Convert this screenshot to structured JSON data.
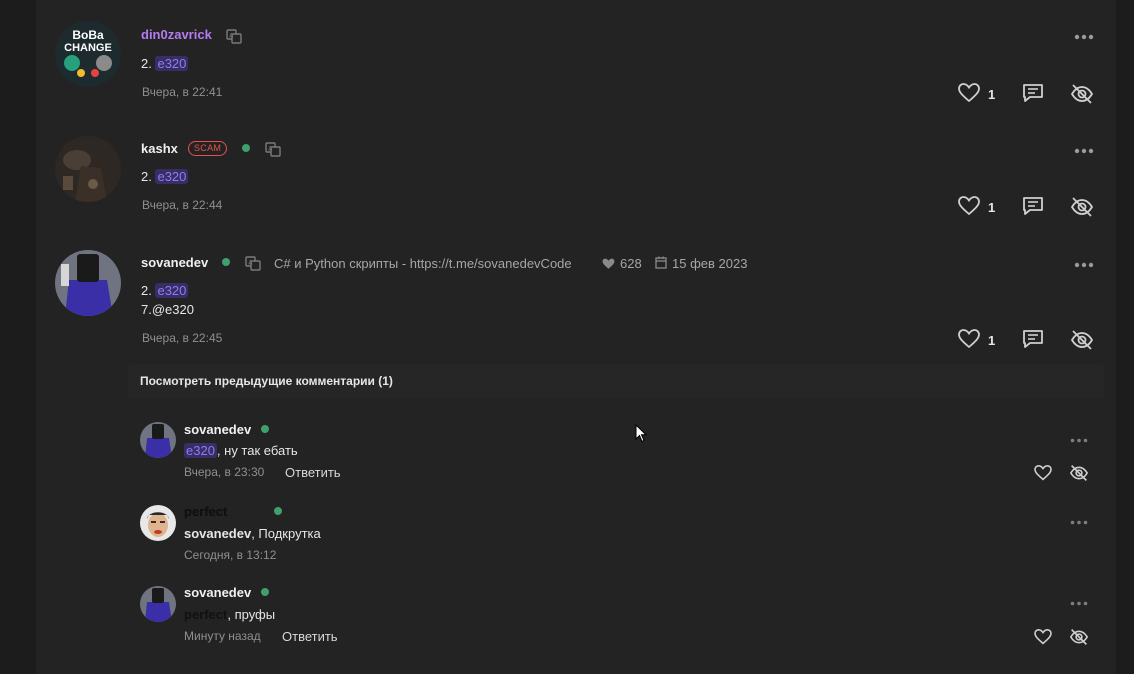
{
  "posts": [
    {
      "username": "din0zavrick",
      "number_label": "2.",
      "mention": "e320",
      "timestamp": "Вчера, в 22:41",
      "likes": "1"
    },
    {
      "username": "kashx",
      "badge": "SCAM",
      "number_label": "2.",
      "mention": "e320",
      "timestamp": "Вчера, в 22:44",
      "likes": "1"
    },
    {
      "username": "sovanedev",
      "status": "C# и Python скрипты - https://t.me/sovanedevCode",
      "reputation": "628",
      "registered": "15 фев 2023",
      "number_label": "2.",
      "mention": "e320",
      "line2": "7.@e320",
      "timestamp": "Вчера, в 22:45",
      "likes": "1"
    }
  ],
  "avatar_text": {
    "line1": "BoBa",
    "line2": "CHANGE"
  },
  "show_previous": "Посмотреть предыдущие комментарии (1)",
  "comments": [
    {
      "username": "sovanedev",
      "mention": "e320",
      "text": ", ну так ебать",
      "timestamp": "Вчера, в 23:30",
      "reply": "Ответить"
    },
    {
      "username": "perfect",
      "mention": "sovanedev",
      "text": ", Подкрутка",
      "timestamp": "Сегодня, в 13:12"
    },
    {
      "username": "sovanedev",
      "mention": "perfect",
      "text": ", пруфы",
      "timestamp": "Минуту назад",
      "reply": "Ответить"
    }
  ],
  "colors": {
    "mention_fg": "#8b7df2",
    "mention_bg": "#3a2d66",
    "online": "#3fa06d",
    "scam": "#e3524f",
    "username_purple": "#b57cf0"
  }
}
